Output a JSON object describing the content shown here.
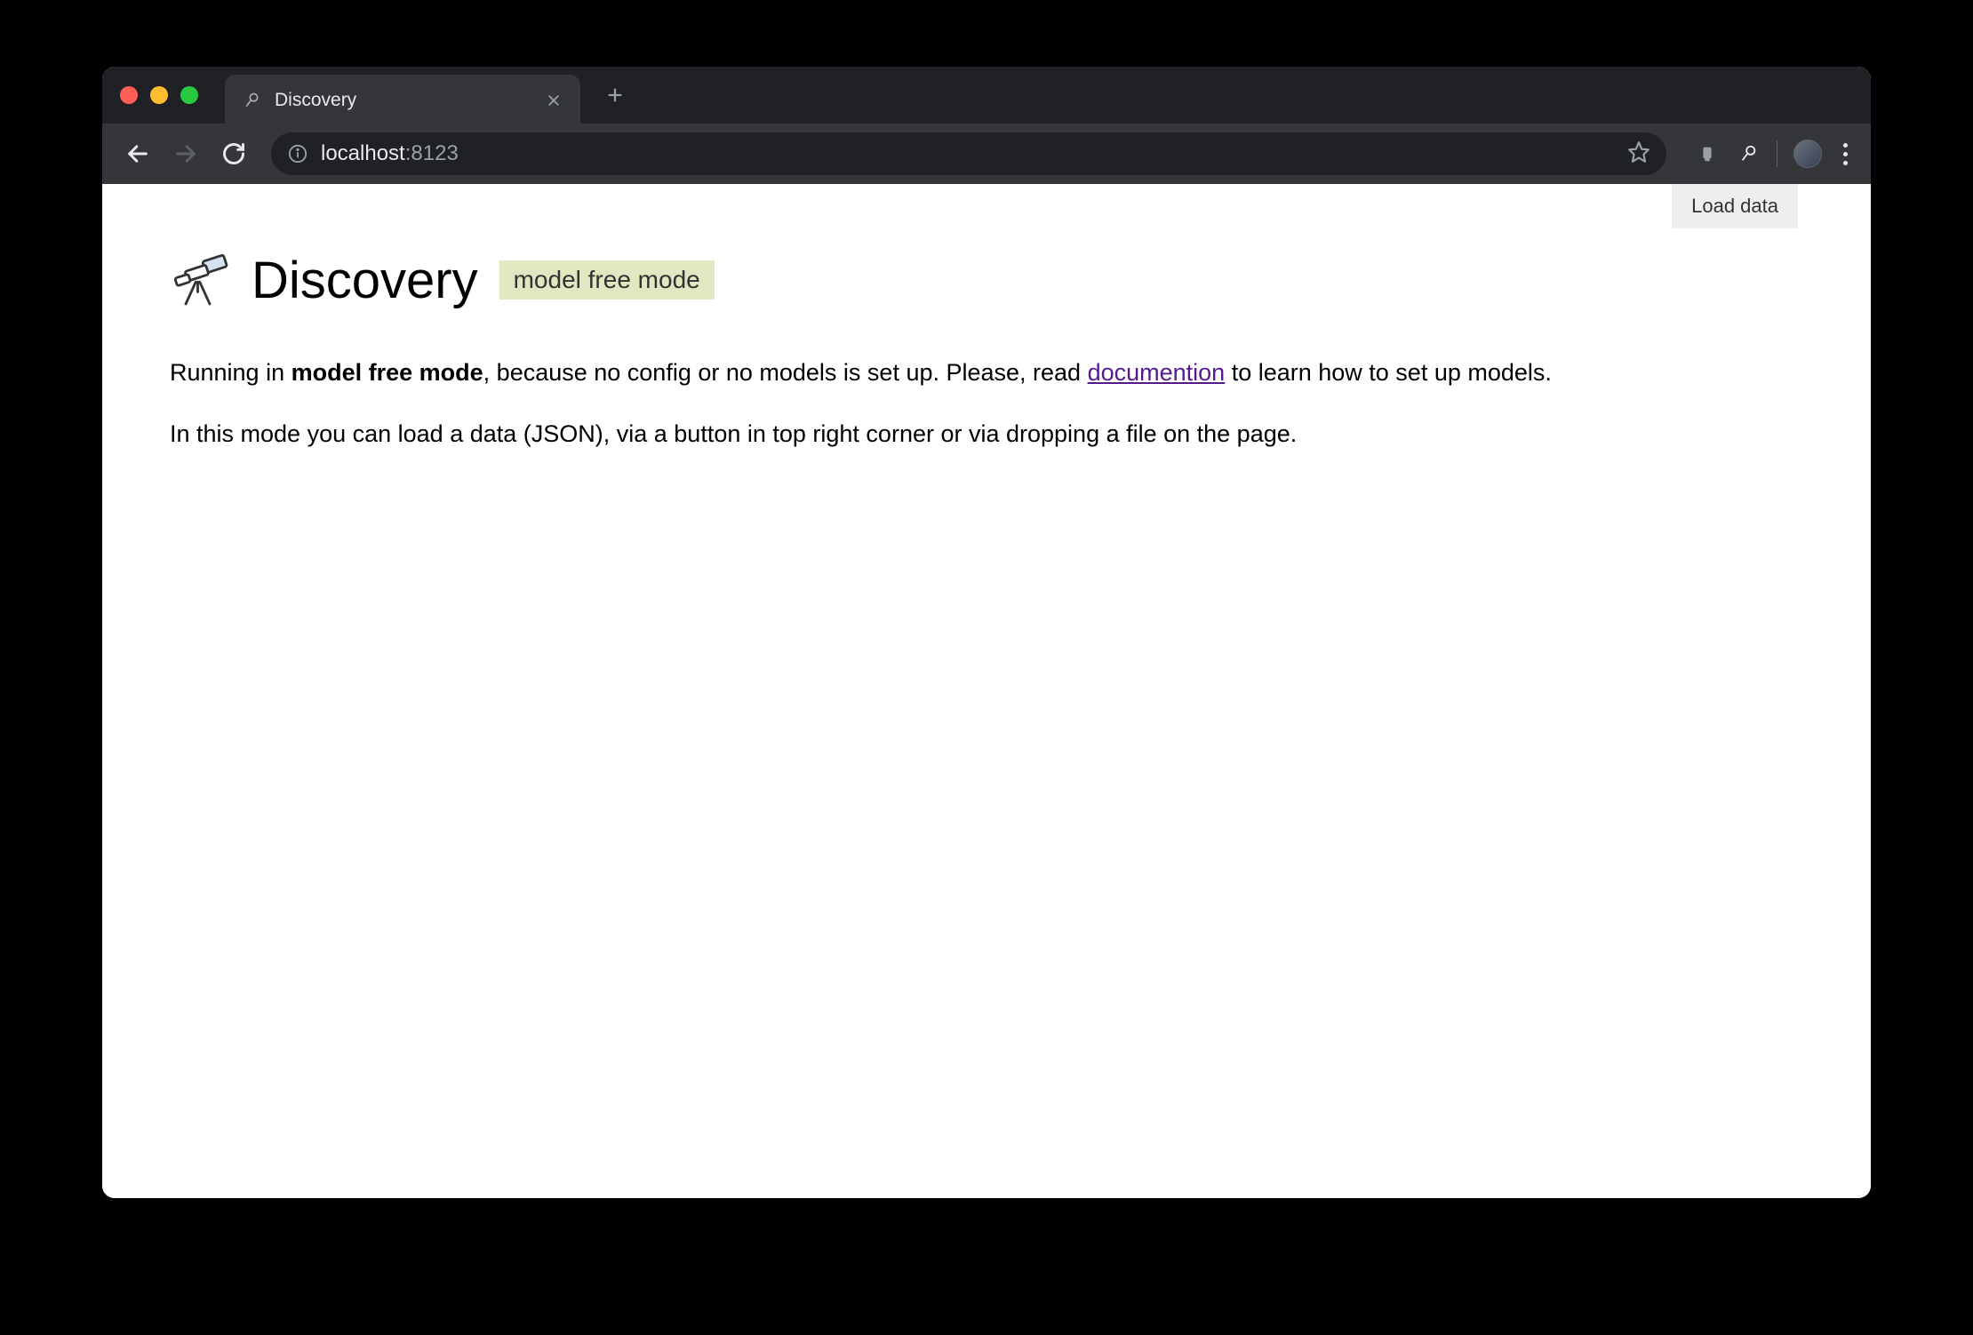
{
  "browser": {
    "tab_title": "Discovery",
    "url_host": "localhost",
    "url_port": ":8123"
  },
  "page": {
    "load_data_label": "Load data",
    "title": "Discovery",
    "mode_badge": "model free mode",
    "paragraph1": {
      "prefix": "Running in ",
      "bold": "model free mode",
      "mid": ", because no config or no models is set up. Please, read ",
      "link": "documention",
      "suffix": " to learn how to set up models."
    },
    "paragraph2": "In this mode you can load a data (JSON), via a button in top right corner or via dropping a file on the page."
  }
}
